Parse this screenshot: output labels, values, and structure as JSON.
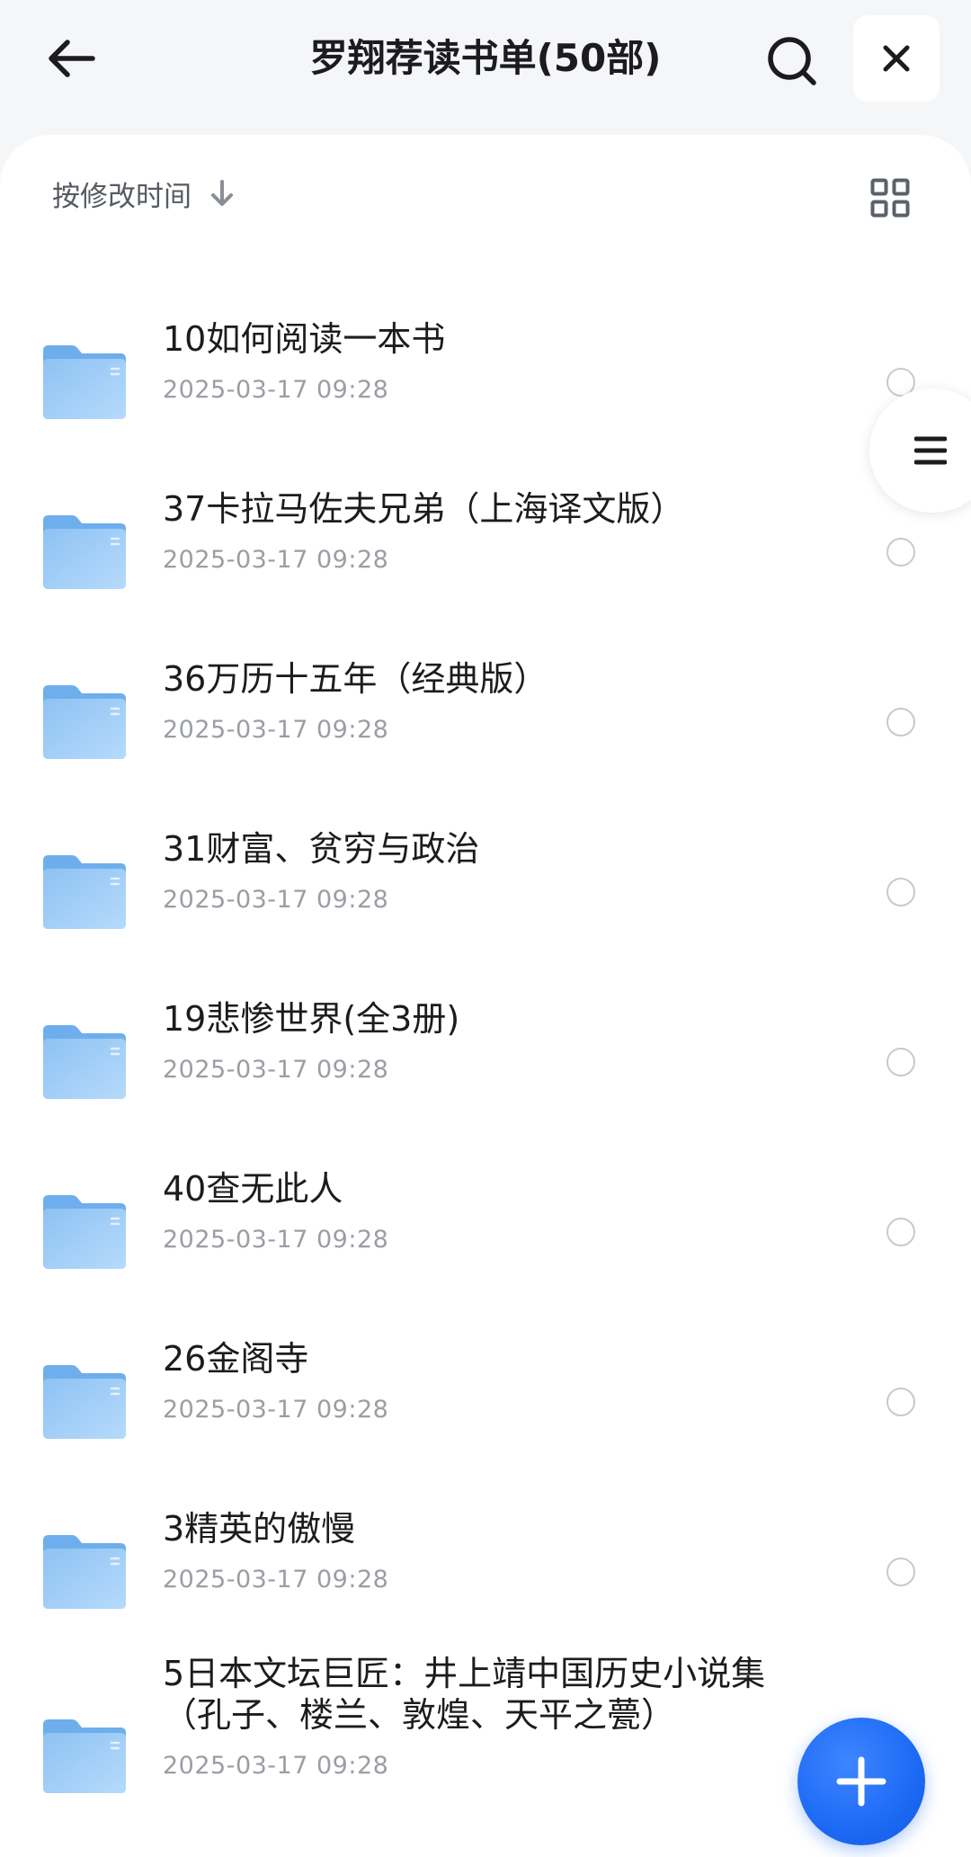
{
  "header": {
    "title": "罗翔荐读书单(50部)"
  },
  "toolbar": {
    "sort_label": "按修改时间"
  },
  "icons": {
    "back": "arrow-left-icon",
    "search": "search-icon",
    "close": "close-icon",
    "sort": "arrow-down-icon",
    "grid": "grid-view-icon",
    "folder": "folder-icon",
    "menu": "menu-icon",
    "add": "plus-icon"
  },
  "colors": {
    "accent": "#1d6af5",
    "folder_top": "#7fb8f0",
    "folder_body": "#9fcdf6",
    "text_primary": "#1c1c1e",
    "text_secondary": "#9a9ea4"
  },
  "files": [
    {
      "name": "10如何阅读一本书",
      "date": "2025-03-17 09:28"
    },
    {
      "name": "37卡拉马佐夫兄弟（上海译文版）",
      "date": "2025-03-17 09:28"
    },
    {
      "name": "36万历十五年（经典版）",
      "date": "2025-03-17 09:28"
    },
    {
      "name": "31财富、贫穷与政治",
      "date": "2025-03-17 09:28"
    },
    {
      "name": "19悲惨世界(全3册)",
      "date": "2025-03-17 09:28"
    },
    {
      "name": "40查无此人",
      "date": "2025-03-17 09:28"
    },
    {
      "name": "26金阁寺",
      "date": "2025-03-17 09:28"
    },
    {
      "name": "3精英的傲慢",
      "date": "2025-03-17 09:28"
    },
    {
      "name": "5日本文坛巨匠：井上靖中国历史小说集（孔子、楼兰、敦煌、天平之甍）",
      "date": "2025-03-17 09:28"
    }
  ]
}
